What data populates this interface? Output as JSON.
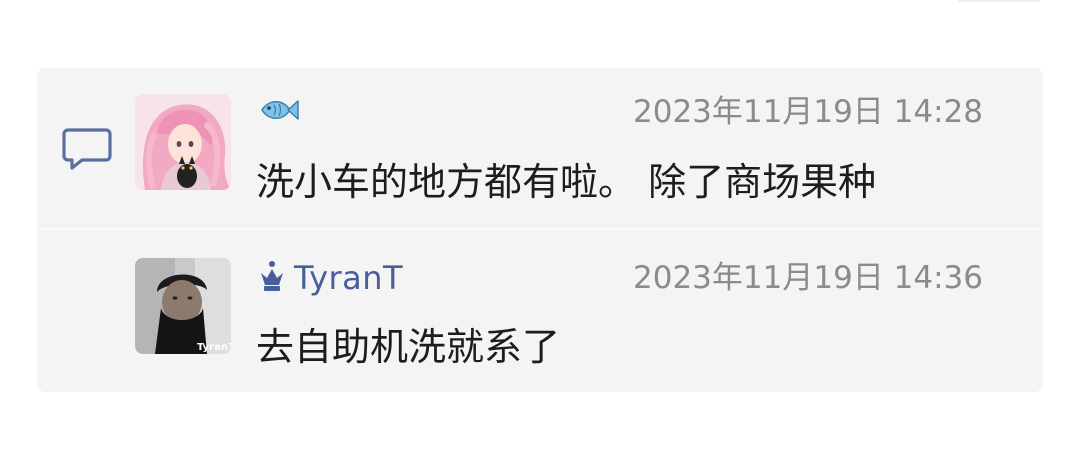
{
  "comments": [
    {
      "username": "",
      "badge_icon": "fish-icon",
      "timestamp": "2023年11月19日 14:28",
      "text": "洗小车的地方都有啦。 除了商场果种",
      "avatar": "anime-girl-avatar"
    },
    {
      "username": "TyranT",
      "badge_icon": "crown-icon",
      "timestamp": "2023年11月19日 14:36",
      "text": "去自助机洗就系了",
      "avatar": "masked-person-avatar",
      "avatar_caption": "TyranT"
    }
  ],
  "section_icon": "comment-bubble-icon",
  "colors": {
    "panel_bg": "#f4f4f5",
    "username": "#4a5e9b",
    "timestamp": "#8b8b8b",
    "message": "#1d1d1d",
    "icon": "#5a6f9e"
  }
}
